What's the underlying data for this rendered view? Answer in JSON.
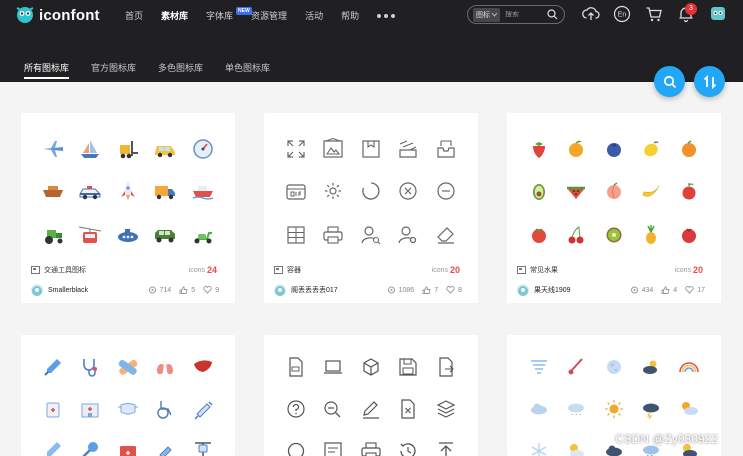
{
  "header": {
    "logo_text": "iconfont",
    "nav": [
      {
        "label": "首页",
        "active": false
      },
      {
        "label": "素材库",
        "active": true
      },
      {
        "label": "字体库",
        "active": false,
        "badge": "NEW"
      },
      {
        "label": "资源管理",
        "active": false
      },
      {
        "label": "活动",
        "active": false
      },
      {
        "label": "帮助",
        "active": false
      }
    ],
    "search": {
      "type_label": "图标",
      "placeholder": "搜索"
    },
    "icons": [
      "upload-icon",
      "language-icon",
      "cart-icon",
      "bell-icon",
      "user-avatar"
    ],
    "language_label": "En",
    "notification_count": "3"
  },
  "tabs": [
    {
      "label": "所有图标库",
      "active": true
    },
    {
      "label": "官方图标库",
      "active": false
    },
    {
      "label": "多色图标库",
      "active": false
    },
    {
      "label": "单色图标库",
      "active": false
    }
  ],
  "floating_buttons": [
    "search-icon",
    "sort-icon"
  ],
  "cards": [
    {
      "title": "交通工具图标",
      "count_label": "icons",
      "count": "24",
      "author": "Smallerblack",
      "stats": {
        "views": "714",
        "likes": "5",
        "favorites": "9"
      }
    },
    {
      "title": "容器",
      "count_label": "icons",
      "count": "20",
      "author": "阁丢丢丢丢017",
      "stats": {
        "views": "1086",
        "likes": "7",
        "favorites": "8"
      }
    },
    {
      "title": "常见水果",
      "count_label": "icons",
      "count": "20",
      "author": "果天线1909",
      "stats": {
        "views": "434",
        "likes": "4",
        "favorites": "17"
      }
    },
    {
      "title": "",
      "count_label": "",
      "count": "",
      "author": "",
      "stats": {}
    },
    {
      "title": "",
      "count_label": "",
      "count": "",
      "author": "",
      "stats": {}
    },
    {
      "title": "",
      "count_label": "",
      "count": "",
      "author": "",
      "stats": {}
    }
  ],
  "colors": {
    "header_bg": "#202023",
    "accent": "#21a7f5",
    "count": "#e94b4b",
    "page_bg": "#f4f4f4"
  },
  "watermark": "CSDN @Zy030922"
}
